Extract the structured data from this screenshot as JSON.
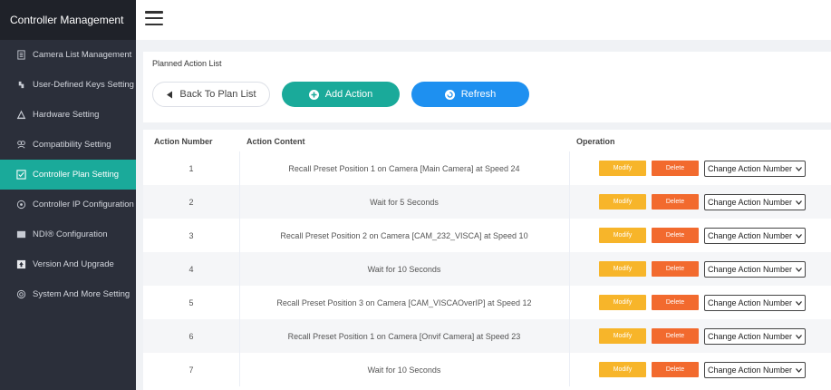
{
  "sidebar": {
    "title": "Controller Management",
    "items": [
      {
        "label": "Camera List Management",
        "icon": "camera-list-icon"
      },
      {
        "label": "User-Defined Keys Setting",
        "icon": "keys-icon"
      },
      {
        "label": "Hardware Setting",
        "icon": "hardware-icon"
      },
      {
        "label": "Compatibility Setting",
        "icon": "compatibility-icon"
      },
      {
        "label": "Controller Plan Setting",
        "icon": "plan-checkbox-icon",
        "active": true
      },
      {
        "label": "Controller IP Configuration",
        "icon": "ip-config-icon"
      },
      {
        "label": "NDI® Configuration",
        "icon": "ndi-icon"
      },
      {
        "label": "Version And Upgrade",
        "icon": "upgrade-icon"
      },
      {
        "label": "System And More Setting",
        "icon": "system-settings-icon"
      }
    ]
  },
  "header": {
    "menu_icon": "hamburger-menu-icon"
  },
  "panel": {
    "title": "Planned Action List",
    "buttons": {
      "back": "Back To Plan List",
      "add": "Add Action",
      "refresh": "Refresh"
    }
  },
  "table": {
    "columns": {
      "number": "Action Number",
      "content": "Action Content",
      "operation": "Operation"
    },
    "modify_label": "Modify",
    "delete_label": "Delete",
    "select_label": "Change Action Number",
    "rows": [
      {
        "number": "1",
        "content": "Recall Preset Position 1 on Camera [Main Camera] at Speed 24"
      },
      {
        "number": "2",
        "content": "Wait for 5 Seconds"
      },
      {
        "number": "3",
        "content": "Recall Preset Position 2 on Camera [CAM_232_VISCA] at Speed 10"
      },
      {
        "number": "4",
        "content": "Wait for 10 Seconds"
      },
      {
        "number": "5",
        "content": "Recall Preset Position 3 on Camera [CAM_VISCAOverIP] at Speed 12"
      },
      {
        "number": "6",
        "content": "Recall Preset Position 1 on Camera [Onvif Camera] at Speed 23"
      },
      {
        "number": "7",
        "content": "Wait for 10 Seconds"
      }
    ]
  },
  "colors": {
    "sidebar_bg": "#2b2f3a",
    "accent_teal": "#1aaa9a",
    "refresh_blue": "#1e90f0",
    "modify_yellow": "#f7b52a",
    "delete_orange": "#f26a2e"
  }
}
